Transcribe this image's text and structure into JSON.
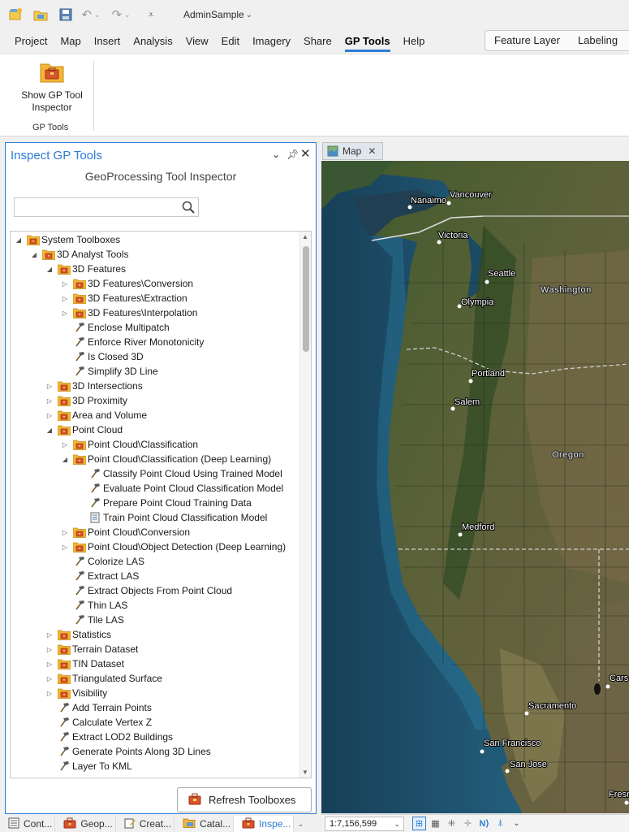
{
  "app": {
    "project_name": "AdminSample"
  },
  "ribbon_tabs": [
    "Project",
    "Map",
    "Insert",
    "Analysis",
    "View",
    "Edit",
    "Imagery",
    "Share",
    "GP Tools",
    "Help"
  ],
  "active_tab": "GP Tools",
  "context_tabs": [
    "Feature Layer",
    "Labeling"
  ],
  "ribbon": {
    "button_label": "Show GP Tool Inspector",
    "group_label": "GP Tools"
  },
  "pane": {
    "title": "Inspect GP Tools",
    "subtitle": "GeoProcessing Tool Inspector",
    "search_value": "",
    "refresh_label": "Refresh Toolboxes"
  },
  "tree": [
    {
      "label": "System Toolboxes",
      "level": 0,
      "toggle": "expanded",
      "icon": "toolbox-icon"
    },
    {
      "label": "3D Analyst Tools",
      "level": 1,
      "toggle": "expanded",
      "icon": "toolbox-icon"
    },
    {
      "label": "3D Features",
      "level": 2,
      "toggle": "expanded",
      "icon": "toolbox-icon"
    },
    {
      "label": "3D Features\\Conversion",
      "level": 3,
      "toggle": "collapsed",
      "icon": "toolbox-icon"
    },
    {
      "label": "3D Features\\Extraction",
      "level": 3,
      "toggle": "collapsed",
      "icon": "toolbox-icon"
    },
    {
      "label": "3D Features\\Interpolation",
      "level": 3,
      "toggle": "collapsed",
      "icon": "toolbox-icon"
    },
    {
      "label": "Enclose Multipatch",
      "level": 3,
      "toggle": "none",
      "icon": "hammer-icon"
    },
    {
      "label": "Enforce River Monotonicity",
      "level": 3,
      "toggle": "none",
      "icon": "hammer-icon"
    },
    {
      "label": "Is Closed 3D",
      "level": 3,
      "toggle": "none",
      "icon": "hammer-icon"
    },
    {
      "label": "Simplify 3D Line",
      "level": 3,
      "toggle": "none",
      "icon": "hammer-icon"
    },
    {
      "label": "3D Intersections",
      "level": 2,
      "toggle": "collapsed",
      "icon": "toolbox-icon"
    },
    {
      "label": "3D Proximity",
      "level": 2,
      "toggle": "collapsed",
      "icon": "toolbox-icon"
    },
    {
      "label": "Area and Volume",
      "level": 2,
      "toggle": "collapsed",
      "icon": "toolbox-icon"
    },
    {
      "label": "Point Cloud",
      "level": 2,
      "toggle": "expanded",
      "icon": "toolbox-icon"
    },
    {
      "label": "Point Cloud\\Classification",
      "level": 3,
      "toggle": "collapsed",
      "icon": "toolbox-icon"
    },
    {
      "label": "Point Cloud\\Classification (Deep Learning)",
      "level": 3,
      "toggle": "expanded",
      "icon": "toolbox-icon"
    },
    {
      "label": "Classify Point Cloud Using Trained Model",
      "level": 4,
      "toggle": "none",
      "icon": "hammer-icon"
    },
    {
      "label": "Evaluate Point Cloud Classification Model",
      "level": 4,
      "toggle": "none",
      "icon": "hammer-icon"
    },
    {
      "label": "Prepare Point Cloud Training Data",
      "level": 4,
      "toggle": "none",
      "icon": "hammer-icon"
    },
    {
      "label": "Train Point Cloud Classification Model",
      "level": 4,
      "toggle": "none",
      "icon": "script-icon"
    },
    {
      "label": "Point Cloud\\Conversion",
      "level": 3,
      "toggle": "collapsed",
      "icon": "toolbox-icon"
    },
    {
      "label": "Point Cloud\\Object Detection (Deep Learning)",
      "level": 3,
      "toggle": "collapsed",
      "icon": "toolbox-icon"
    },
    {
      "label": "Colorize LAS",
      "level": 3,
      "toggle": "none",
      "icon": "hammer-icon"
    },
    {
      "label": "Extract LAS",
      "level": 3,
      "toggle": "none",
      "icon": "hammer-icon"
    },
    {
      "label": "Extract Objects From Point Cloud",
      "level": 3,
      "toggle": "none",
      "icon": "hammer-icon"
    },
    {
      "label": "Thin LAS",
      "level": 3,
      "toggle": "none",
      "icon": "hammer-icon"
    },
    {
      "label": "Tile LAS",
      "level": 3,
      "toggle": "none",
      "icon": "hammer-icon"
    },
    {
      "label": "Statistics",
      "level": 2,
      "toggle": "collapsed",
      "icon": "toolbox-icon"
    },
    {
      "label": "Terrain Dataset",
      "level": 2,
      "toggle": "collapsed",
      "icon": "toolbox-icon"
    },
    {
      "label": "TIN Dataset",
      "level": 2,
      "toggle": "collapsed",
      "icon": "toolbox-icon"
    },
    {
      "label": "Triangulated Surface",
      "level": 2,
      "toggle": "collapsed",
      "icon": "toolbox-icon"
    },
    {
      "label": "Visibility",
      "level": 2,
      "toggle": "collapsed",
      "icon": "toolbox-icon"
    },
    {
      "label": "Add Terrain Points",
      "level": 2,
      "toggle": "none",
      "icon": "hammer-icon"
    },
    {
      "label": "Calculate Vertex Z",
      "level": 2,
      "toggle": "none",
      "icon": "hammer-icon"
    },
    {
      "label": "Extract LOD2 Buildings",
      "level": 2,
      "toggle": "none",
      "icon": "hammer-icon"
    },
    {
      "label": "Generate Points Along 3D Lines",
      "level": 2,
      "toggle": "none",
      "icon": "hammer-icon"
    },
    {
      "label": "Layer To KML",
      "level": 2,
      "toggle": "none",
      "icon": "hammer-icon"
    }
  ],
  "dock_tabs": [
    {
      "label": "Cont...",
      "icon": "contents-icon",
      "active": false
    },
    {
      "label": "Geop...",
      "icon": "toolbox-icon",
      "active": false
    },
    {
      "label": "Creat...",
      "icon": "create-features-icon",
      "active": false
    },
    {
      "label": "Catal...",
      "icon": "catalog-icon",
      "active": false
    },
    {
      "label": "Inspe...",
      "icon": "toolbox-icon",
      "active": true
    }
  ],
  "map": {
    "tab_label": "Map",
    "scale": "1:7,156,599",
    "cities": [
      "Nanaimo",
      "Vancouver",
      "Victoria",
      "Seattle",
      "Olympia",
      "Portland",
      "Salem",
      "Medford",
      "Sacramento",
      "San Francisco",
      "San Jose",
      "Cars",
      "Fresr"
    ],
    "regions": [
      "Washington",
      "Oregon"
    ]
  },
  "colors": {
    "accent": "#2b7cd3",
    "ocean": "#1f5b7a",
    "land": "#4d5a36"
  }
}
